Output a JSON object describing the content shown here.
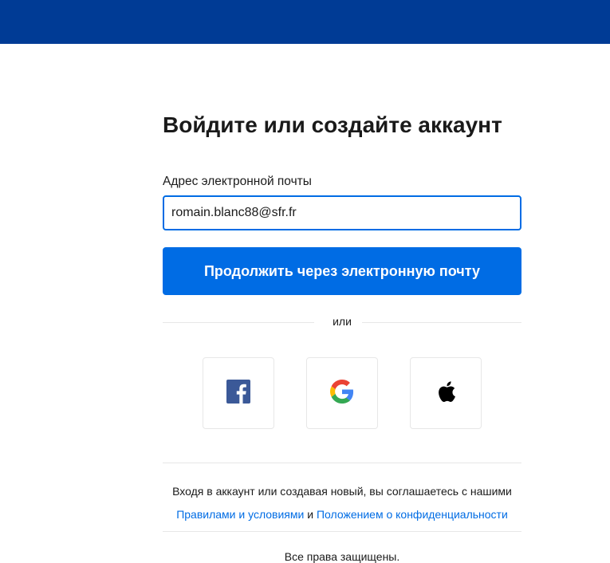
{
  "header": {
    "bg_color": "#003b95"
  },
  "signin": {
    "title": "Войдите или создайте аккаунт",
    "email_label": "Адрес электронной почты",
    "email_value": "romain.blanc88@sfr.fr",
    "continue_label": "Продолжить через электронную почту",
    "divider_text": "или",
    "accent_color": "#006ce4"
  },
  "social": [
    {
      "icon": "facebook-icon"
    },
    {
      "icon": "google-icon"
    },
    {
      "icon": "apple-icon"
    }
  ],
  "footer": {
    "terms_prefix": "Входя в аккаунт или создавая новый, вы соглашаетесь с нашими",
    "terms_link": "Правилами и условиями",
    "terms_conj": "и",
    "privacy_link": "Положением о конфиденциальности",
    "rights": "Все права защищены."
  }
}
